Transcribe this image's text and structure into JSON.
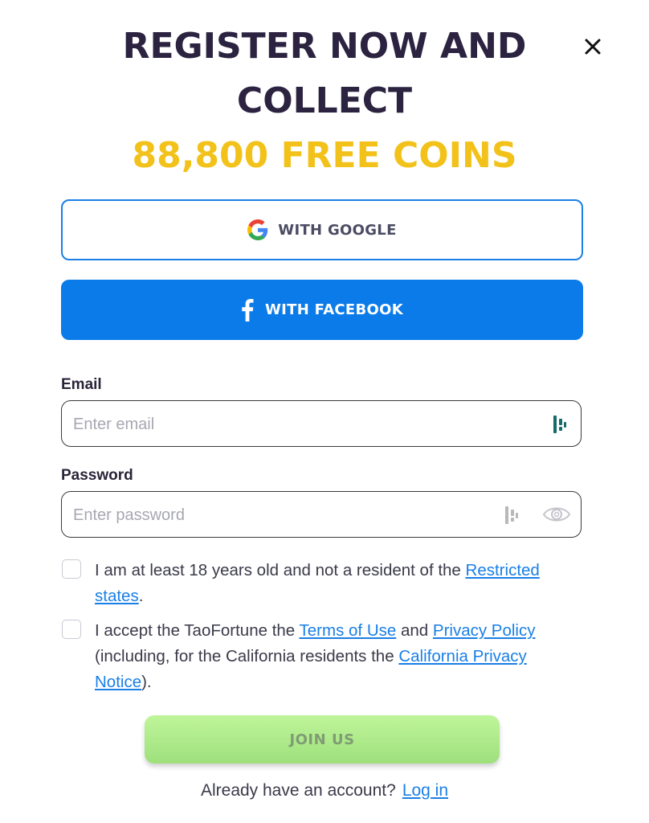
{
  "headline": {
    "line1": "REGISTER NOW AND",
    "line2": "COLLECT",
    "line3": "88,800 FREE COINS"
  },
  "social": {
    "google_label": "WITH GOOGLE",
    "facebook_label": "WITH FACEBOOK"
  },
  "form": {
    "email_label": "Email",
    "email_placeholder": "Enter email",
    "email_value": "",
    "password_label": "Password",
    "password_placeholder": "Enter password",
    "password_value": ""
  },
  "consent": {
    "age_checked": false,
    "age_text": "I am at least 18 years old and not a resident of the ",
    "age_link": "Restricted states",
    "age_tail": ".",
    "terms_checked": false,
    "terms_text1": "I accept the TaoFortune the ",
    "terms_link1": "Terms of Use",
    "terms_text2": " and ",
    "terms_link2": "Privacy Policy",
    "terms_text3": " (including, for the California residents the ",
    "terms_link3": "California Privacy Notice",
    "terms_tail": ")."
  },
  "join_label": "JOIN US",
  "footer": {
    "prompt": "Already have an account?",
    "login_link": "Log in"
  },
  "colors": {
    "title": "#2b2340",
    "accent": "#f2c21b",
    "google_border": "#1a7fe6",
    "facebook": "#0b7bea",
    "join": "#b1ec8c",
    "link": "#1a7fe6"
  },
  "icons": [
    "close-icon",
    "google-icon",
    "facebook-icon",
    "password-manager-icon",
    "eye-icon"
  ]
}
